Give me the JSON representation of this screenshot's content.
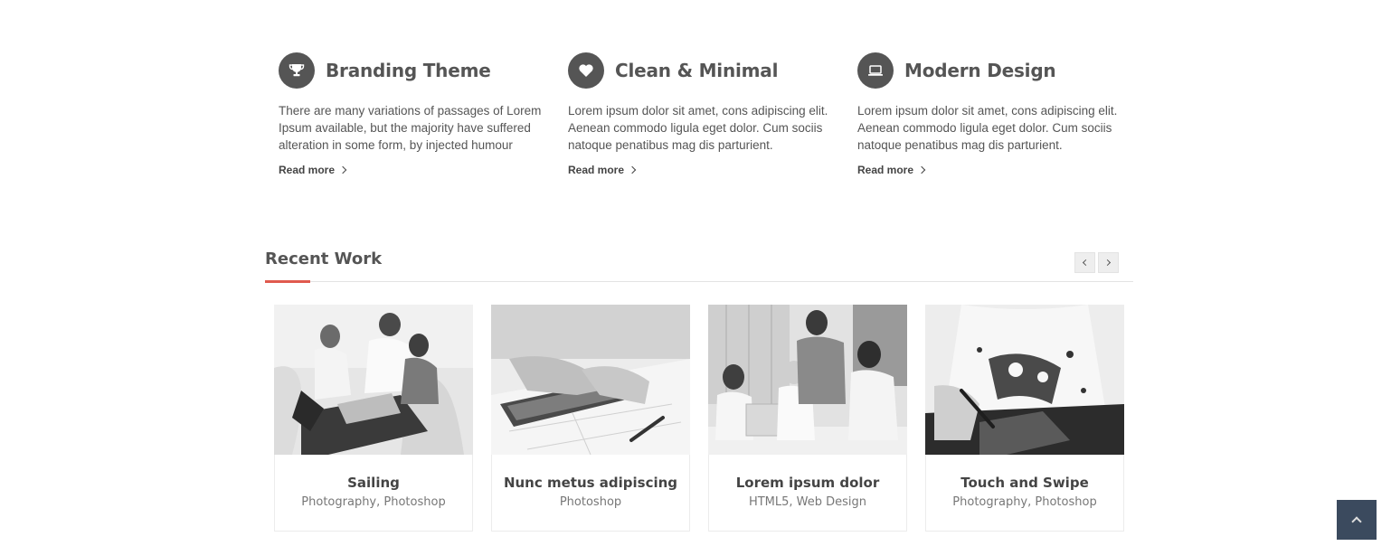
{
  "features": [
    {
      "icon": "trophy-icon",
      "title": "Branding Theme",
      "text": "There are many variations of passages of Lorem Ipsum available, but the majority have suffered alteration in some form, by injected humour",
      "link": "Read more"
    },
    {
      "icon": "heart-icon",
      "title": "Clean & Minimal",
      "text": "Lorem ipsum dolor sit amet, cons adipiscing elit. Aenean commodo ligula eget dolor. Cum sociis natoque penatibus mag dis parturient.",
      "link": "Read more"
    },
    {
      "icon": "laptop-icon",
      "title": "Modern Design",
      "text": "Lorem ipsum dolor sit amet, cons adipiscing elit. Aenean commodo ligula eget dolor. Cum sociis natoque penatibus mag dis parturient.",
      "link": "Read more"
    }
  ],
  "recent_work": {
    "title": "Recent Work",
    "accent_color": "#e05a4e",
    "items": [
      {
        "title": "Sailing",
        "tags": "Photography, Photoshop",
        "image": "team-at-laptop-photo"
      },
      {
        "title": "Nunc metus adipiscing",
        "tags": "Photoshop",
        "image": "tablet-blueprint-photo"
      },
      {
        "title": "Lorem ipsum dolor",
        "tags": "HTML5, Web Design",
        "image": "office-team-photo"
      },
      {
        "title": "Touch and Swipe",
        "tags": "Photography, Photoshop",
        "image": "drawing-tshirt-photo"
      }
    ]
  },
  "back_to_top": {
    "icon": "chevron-up-icon",
    "color": "#3b4a5e"
  }
}
